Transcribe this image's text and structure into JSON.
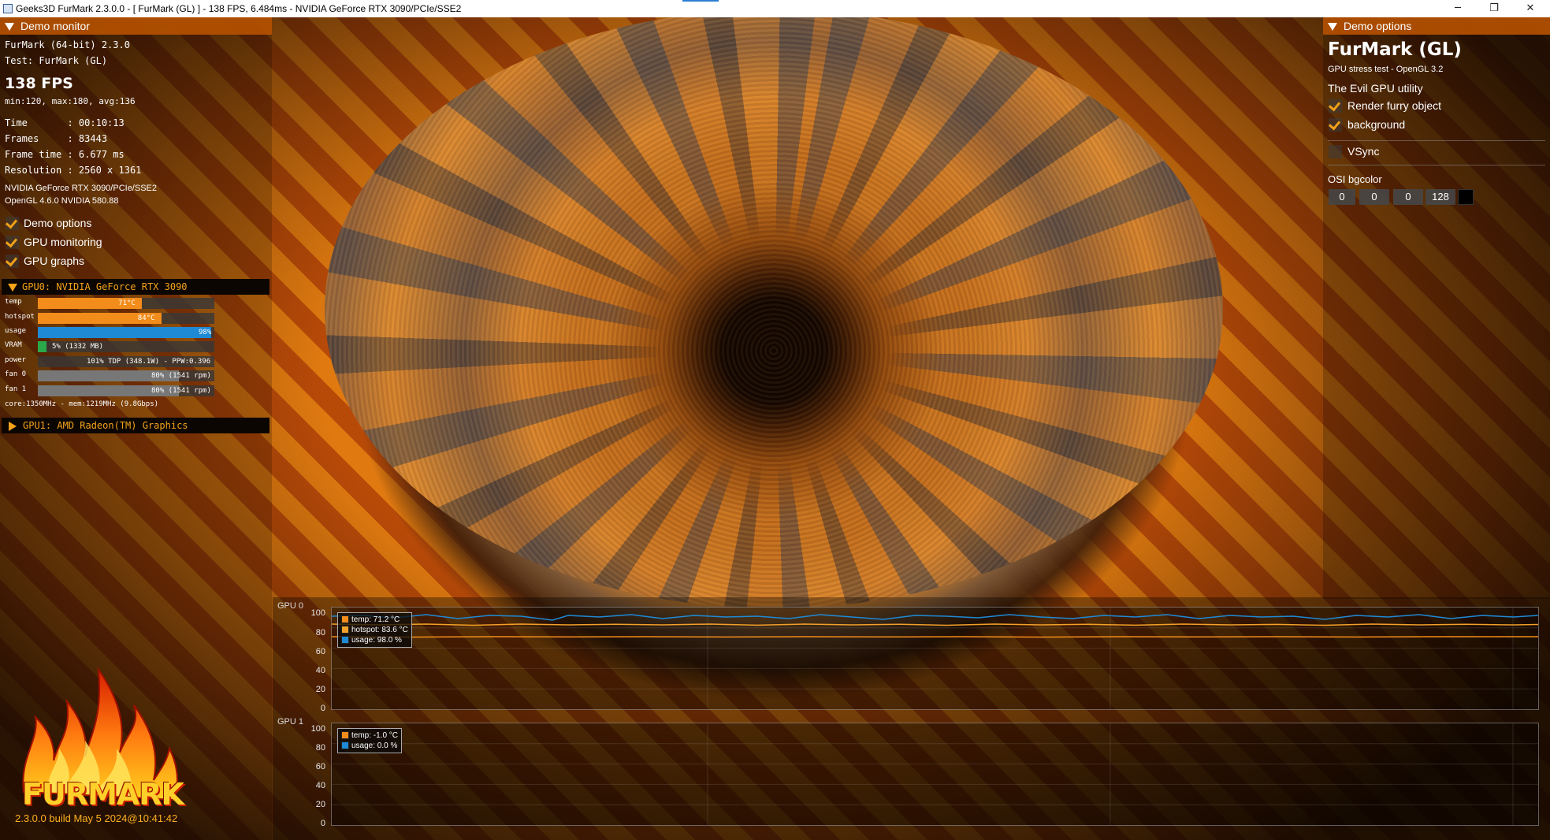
{
  "window": {
    "title": "Geeks3D FurMark 2.3.0.0 - [ FurMark (GL) ] - 138 FPS, 6.484ms - NVIDIA GeForce RTX 3090/PCIe/SSE2",
    "minimize": "─",
    "maximize": "❐",
    "close": "✕"
  },
  "monitor": {
    "header": "Demo monitor",
    "app_line": "FurMark (64-bit) 2.3.0",
    "test_line": "Test: FurMark (GL)",
    "fps": "138 FPS",
    "fps_stats": "min:120, max:180, avg:136",
    "time_line": "Time       : 00:10:13",
    "frames_line": "Frames     : 83443",
    "frametime_line": "Frame time : 6.677 ms",
    "resolution_line": "Resolution : 2560 x 1361",
    "gpu_string": "NVIDIA GeForce RTX 3090/PCIe/SSE2",
    "gl_string": "OpenGL 4.6.0 NVIDIA 580.88",
    "checkboxes": [
      {
        "label": "Demo options",
        "checked": true
      },
      {
        "label": "GPU monitoring",
        "checked": true
      },
      {
        "label": "GPU graphs",
        "checked": true
      }
    ]
  },
  "gpu0": {
    "header": "GPU0: NVIDIA GeForce RTX 3090",
    "stats": [
      {
        "label": "temp",
        "value": "71°C",
        "fraction": 0.59,
        "color": "#f28c1a"
      },
      {
        "label": "hotspot",
        "value": "84°C",
        "fraction": 0.7,
        "color": "#f28c1a"
      },
      {
        "label": "usage",
        "value": "98%",
        "fraction": 0.98,
        "color": "#1e8ad6"
      },
      {
        "label": "VRAM",
        "value": "5% (1332 MB)",
        "fraction": 0.05,
        "color": "#2aa84a"
      },
      {
        "label": "power",
        "value": "101% TDP (348.1W) - PPW:0.396",
        "fraction": 0,
        "color": "#f28c1a"
      },
      {
        "label": "fan 0",
        "value": "80% (1541 rpm)",
        "fraction": 0.8,
        "color": "#777777"
      },
      {
        "label": "fan 1",
        "value": "80% (1541 rpm)",
        "fraction": 0.8,
        "color": "#777777"
      }
    ],
    "clocks": "core:1350MHz - mem:1219MHz (9.8Gbps)"
  },
  "gpu1": {
    "header": "GPU1: AMD Radeon(TM) Graphics"
  },
  "branding": {
    "logo_text": "FURMARK",
    "build": "2.3.0.0 build May  5 2024@10:41:42"
  },
  "options": {
    "header": "Demo options",
    "title": "FurMark (GL)",
    "subtitle": "GPU stress test - OpenGL 3.2",
    "tagline": "The Evil GPU utility",
    "checkboxes": [
      {
        "label": "Render furry object",
        "checked": true
      },
      {
        "label": "background",
        "checked": true
      },
      {
        "label": "VSync",
        "checked": false
      }
    ],
    "bgcolor_label": "OSI bgcolor",
    "bgcolor_values": [
      "0",
      "0",
      "0",
      "128"
    ],
    "bgcolor_swatch": "#000000"
  },
  "graphs": {
    "gpu0": {
      "title": "GPU 0",
      "yticks": [
        "100",
        "80",
        "60",
        "40",
        "20",
        "0"
      ],
      "legend": [
        {
          "label": "temp: 71.2 °C",
          "color": "#f28c1a"
        },
        {
          "label": "hotspot: 83.6 °C",
          "color": "#f2a02a"
        },
        {
          "label": "usage: 98.0 %",
          "color": "#1e8ad6"
        }
      ]
    },
    "gpu1": {
      "title": "GPU 1",
      "yticks": [
        "100",
        "80",
        "60",
        "40",
        "20",
        "0"
      ],
      "legend": [
        {
          "label": "temp: -1.0 °C",
          "color": "#f28c1a"
        },
        {
          "label": "usage: 0.0 %",
          "color": "#1e8ad6"
        }
      ]
    }
  }
}
